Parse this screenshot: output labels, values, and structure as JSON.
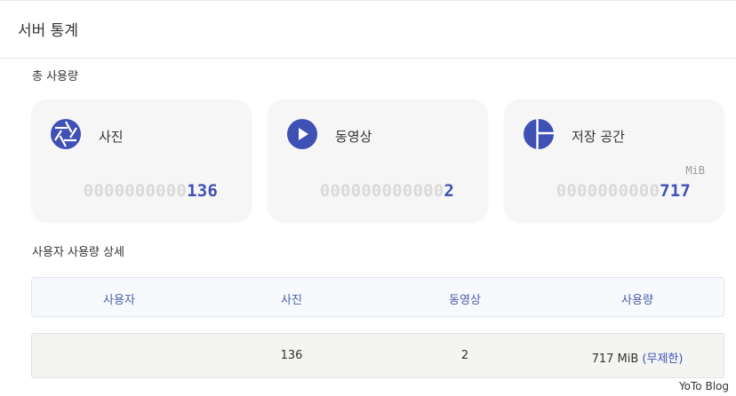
{
  "page": {
    "title": "서버 통계"
  },
  "total_usage": {
    "label": "총 사용량",
    "cards": [
      {
        "label": "사진",
        "padding": "0000000000",
        "value": "136",
        "unit": "",
        "icon": "photo-aperture-icon"
      },
      {
        "label": "동영상",
        "padding": "000000000000",
        "value": "2",
        "unit": "",
        "icon": "video-play-icon"
      },
      {
        "label": "저장 공간",
        "padding": "0000000000",
        "value": "717",
        "unit": "MiB",
        "icon": "storage-pie-icon"
      }
    ]
  },
  "user_usage": {
    "label": "사용자 사용량 상세",
    "columns": [
      "사용자",
      "사진",
      "동영상",
      "사용량"
    ],
    "rows": [
      {
        "user": "",
        "photos": "136",
        "videos": "2",
        "usage": "717 MiB",
        "quota": "(무제한)"
      }
    ]
  },
  "watermark": "YoTo Blog",
  "colors": {
    "accent": "#3f51b5",
    "card_bg": "#f6f6f6",
    "header_bg": "#f7f9fc"
  }
}
